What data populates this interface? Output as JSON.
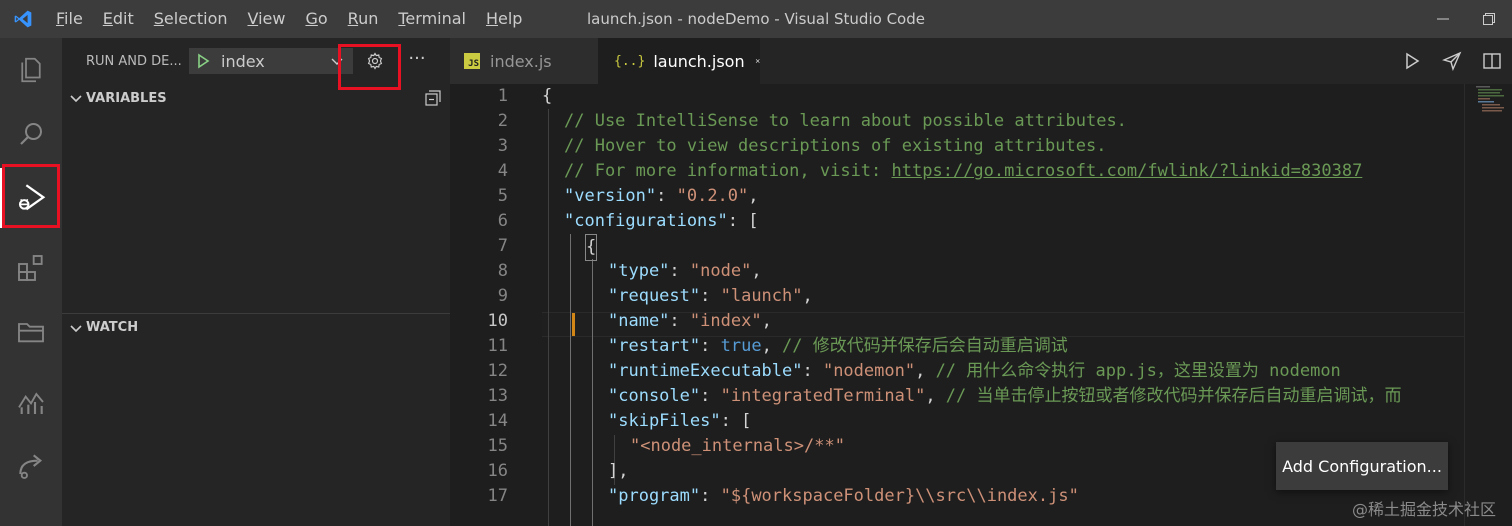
{
  "titlebar": {
    "title": "launch.json - nodeDemo - Visual Studio Code",
    "menu": [
      {
        "pre": "",
        "u": "F",
        "post": "ile"
      },
      {
        "pre": "",
        "u": "E",
        "post": "dit"
      },
      {
        "pre": "",
        "u": "S",
        "post": "election"
      },
      {
        "pre": "",
        "u": "V",
        "post": "iew"
      },
      {
        "pre": "",
        "u": "G",
        "post": "o"
      },
      {
        "pre": "",
        "u": "R",
        "post": "un"
      },
      {
        "pre": "",
        "u": "T",
        "post": "erminal"
      },
      {
        "pre": "",
        "u": "H",
        "post": "elp"
      }
    ]
  },
  "activitybar": {
    "items": [
      "files-icon",
      "search-icon",
      "run-debug-icon",
      "extensions-icon",
      "folder-icon",
      "chart-icon",
      "remote-icon"
    ],
    "active": "run-debug-icon"
  },
  "sidebar": {
    "title": "RUN AND DE...",
    "config_name": "index",
    "more_label": "···",
    "sections": {
      "variables": "VARIABLES",
      "watch": "WATCH"
    }
  },
  "tabs": [
    {
      "label": "index.js",
      "icon": "js-file-icon",
      "active": false
    },
    {
      "label": "launch.json",
      "icon": "json-file-icon",
      "active": true
    }
  ],
  "json_icon_text": "{..}",
  "js_icon_text": "JS",
  "current_line": 10,
  "code": {
    "l1": "{",
    "l2": "// Use IntelliSense to learn about possible attributes.",
    "l3": "// Hover to view descriptions of existing attributes.",
    "l4_pre": "// For more information, visit: ",
    "l4_link": "https://go.microsoft.com/fwlink/?linkid=830387",
    "l5_key": "\"version\"",
    "l5_val": "\"0.2.0\"",
    "l6_key": "\"configurations\"",
    "l7": "{",
    "l8_key": "\"type\"",
    "l8_val": "\"node\"",
    "l9_key": "\"request\"",
    "l9_val": "\"launch\"",
    "l10_key": "\"name\"",
    "l10_val": "\"index\"",
    "l11_key": "\"restart\"",
    "l11_val": "true",
    "l11_comment": "// 修改代码并保存后会自动重启调试",
    "l12_key": "\"runtimeExecutable\"",
    "l12_val": "\"nodemon\"",
    "l12_comment": "// 用什么命令执行 app.js，这里设置为 nodemon",
    "l13_key": "\"console\"",
    "l13_val": "\"integratedTerminal\"",
    "l13_comment": "// 当单击停止按钮或者修改代码并保存后自动重启调试，而",
    "l14_key": "\"skipFiles\"",
    "l15_val": "\"<node_internals>/**\"",
    "l16": "],",
    "l17_key": "\"program\"",
    "l17_val": "\"${workspaceFolder}\\\\src\\\\index.js\""
  },
  "line_numbers": [
    "1",
    "2",
    "3",
    "4",
    "5",
    "6",
    "7",
    "8",
    "9",
    "10",
    "11",
    "12",
    "13",
    "14",
    "15",
    "16",
    "17"
  ],
  "add_config_label": "Add Configuration...",
  "watermark": "@稀土掘金技术社区",
  "colors": {
    "highlight": "#e81123",
    "vscode_blue": "#3794ff",
    "play_green": "#89d185"
  }
}
